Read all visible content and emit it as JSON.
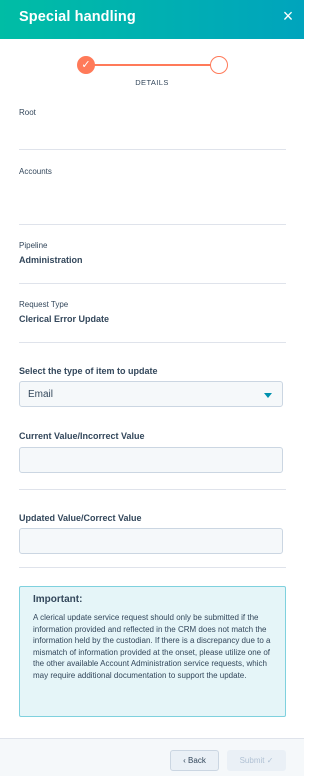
{
  "header": {
    "title": "Special handling",
    "close_glyph": "×"
  },
  "stepper": {
    "step_label": "DETAILS",
    "check_glyph": "✓"
  },
  "fields": {
    "root_label": "Root",
    "accounts_label": "Accounts",
    "pipeline_label": "Pipeline",
    "pipeline_value": "Administration",
    "request_type_label": "Request Type",
    "request_type_value": "Clerical Error Update"
  },
  "form": {
    "item_type_label": "Select the type of item to update",
    "item_type_value": "Email",
    "current_value_label": "Current Value/Incorrect Value",
    "updated_value_label": "Updated Value/Correct Value"
  },
  "notice": {
    "title": "Important:",
    "body": "A clerical update service request should only be submitted if the information provided and reflected in the CRM does not match the information held by the custodian. If there is a discrepancy due to a mismatch of information provided at the onset, please utilize one of the other available Account Administration service requests, which may require additional documentation to support the update."
  },
  "footer": {
    "back_label": "‹ Back",
    "submit_label": "Submit ✓"
  },
  "colors": {
    "accent": "#ff7a59",
    "header_start": "#00bda5",
    "header_end": "#00a4bd",
    "link": "#0091ae"
  }
}
